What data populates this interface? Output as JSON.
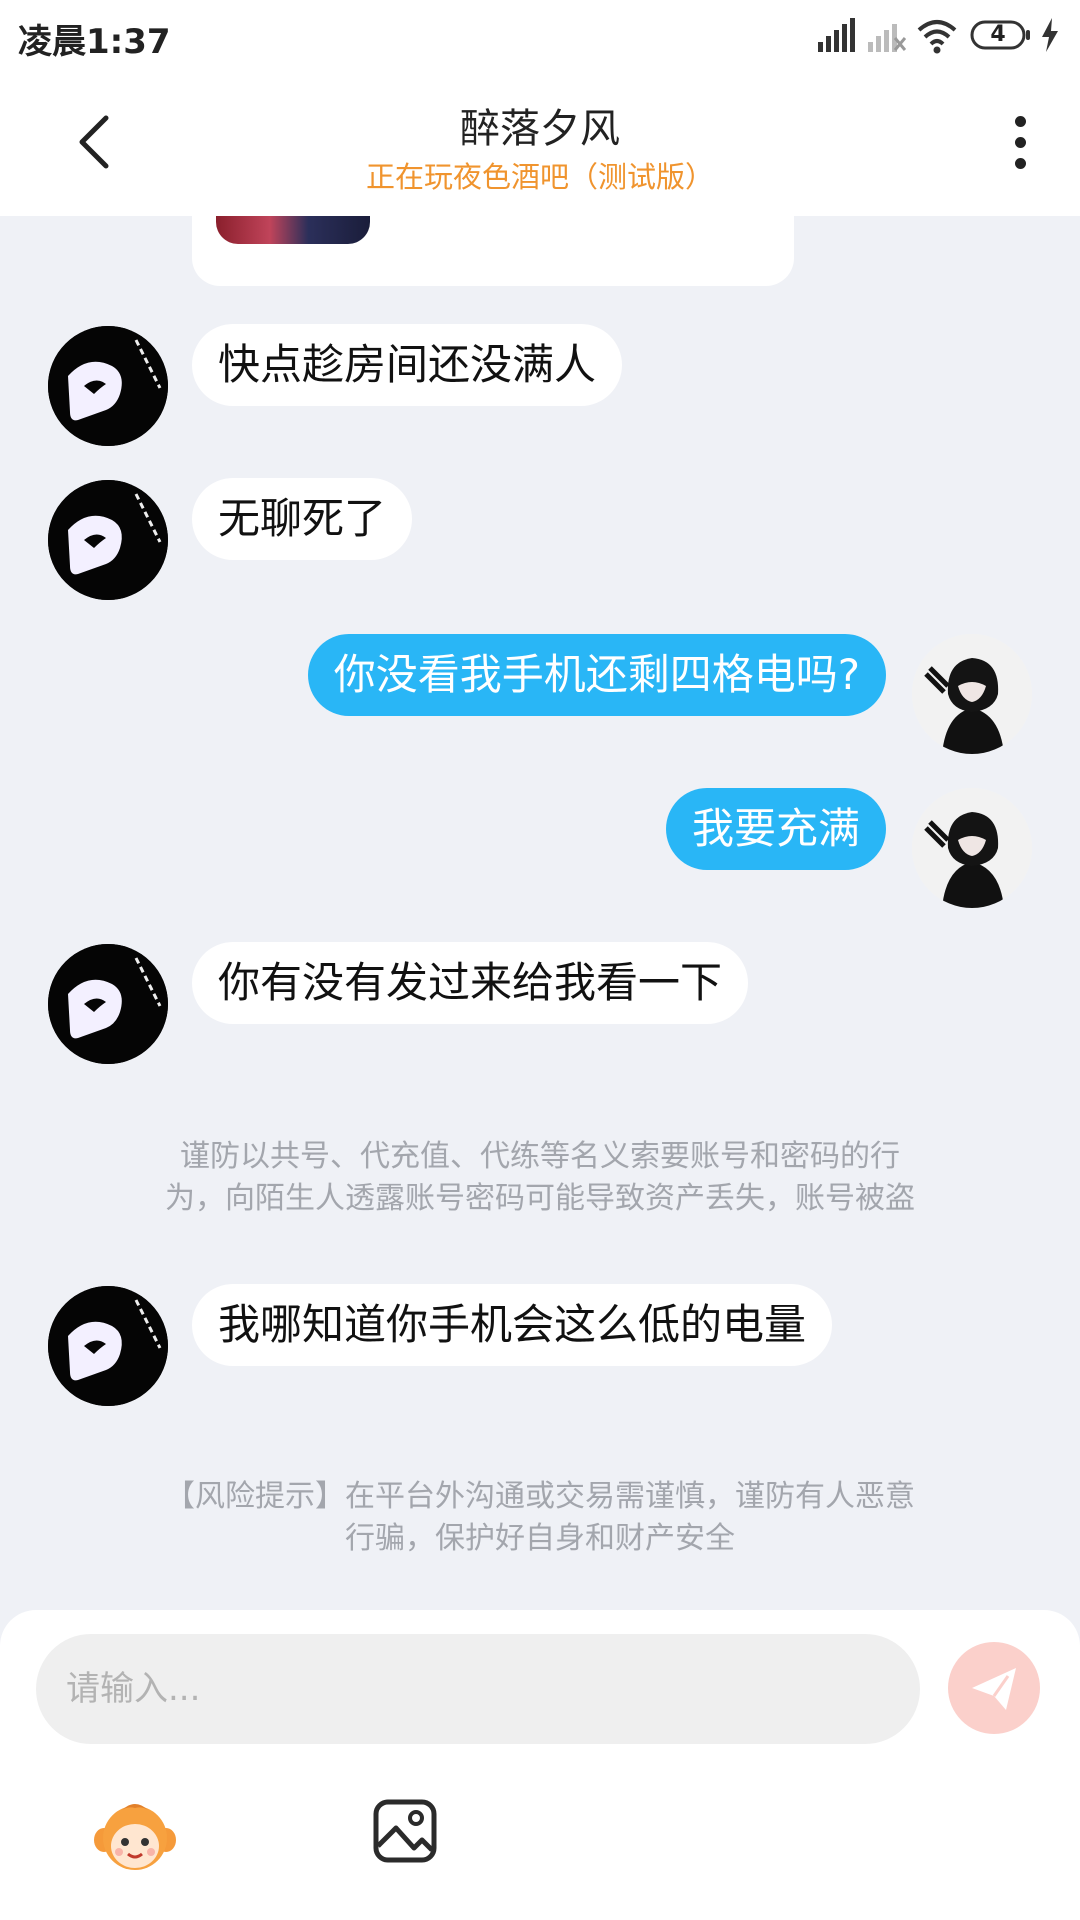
{
  "status_bar": {
    "time": "凌晨1:37",
    "battery_level": "4"
  },
  "header": {
    "title": "醉落夕风",
    "subtitle": "正在玩夜色酒吧（测试版）"
  },
  "messages": [
    {
      "side": "left",
      "text": "快点趁房间还没满人"
    },
    {
      "side": "left",
      "text": "无聊死了"
    },
    {
      "side": "right",
      "text": "你没看我手机还剩四格电吗?"
    },
    {
      "side": "right",
      "text": "我要充满"
    },
    {
      "side": "left",
      "text": "你有没有发过来给我看一下"
    },
    {
      "side": "left",
      "text": "我哪知道你手机会这么低的电量"
    }
  ],
  "notices": {
    "account_warning": {
      "line1": "谨防以共号、代充值、代练等名义索要账号和密码的行",
      "line2": "为，向陌生人透露账号密码可能导致资产丢失，账号被盗"
    },
    "risk_warning": {
      "line1": "【风险提示】在平台外沟通或交易需谨慎，谨防有人恶意",
      "line2": "行骗，保护好自身和财产安全"
    }
  },
  "input": {
    "placeholder": "请输入..."
  },
  "colors": {
    "chat_background": "#eff1f6",
    "sent_bubble": "#29b6f6",
    "subtitle": "#f0942e",
    "send_button": "#fbd0cb"
  },
  "icons": {
    "back": "chevron-left-icon",
    "more": "more-vertical-icon",
    "send": "paper-plane-icon",
    "emoji": "monkey-emoji-icon",
    "image": "image-icon"
  }
}
